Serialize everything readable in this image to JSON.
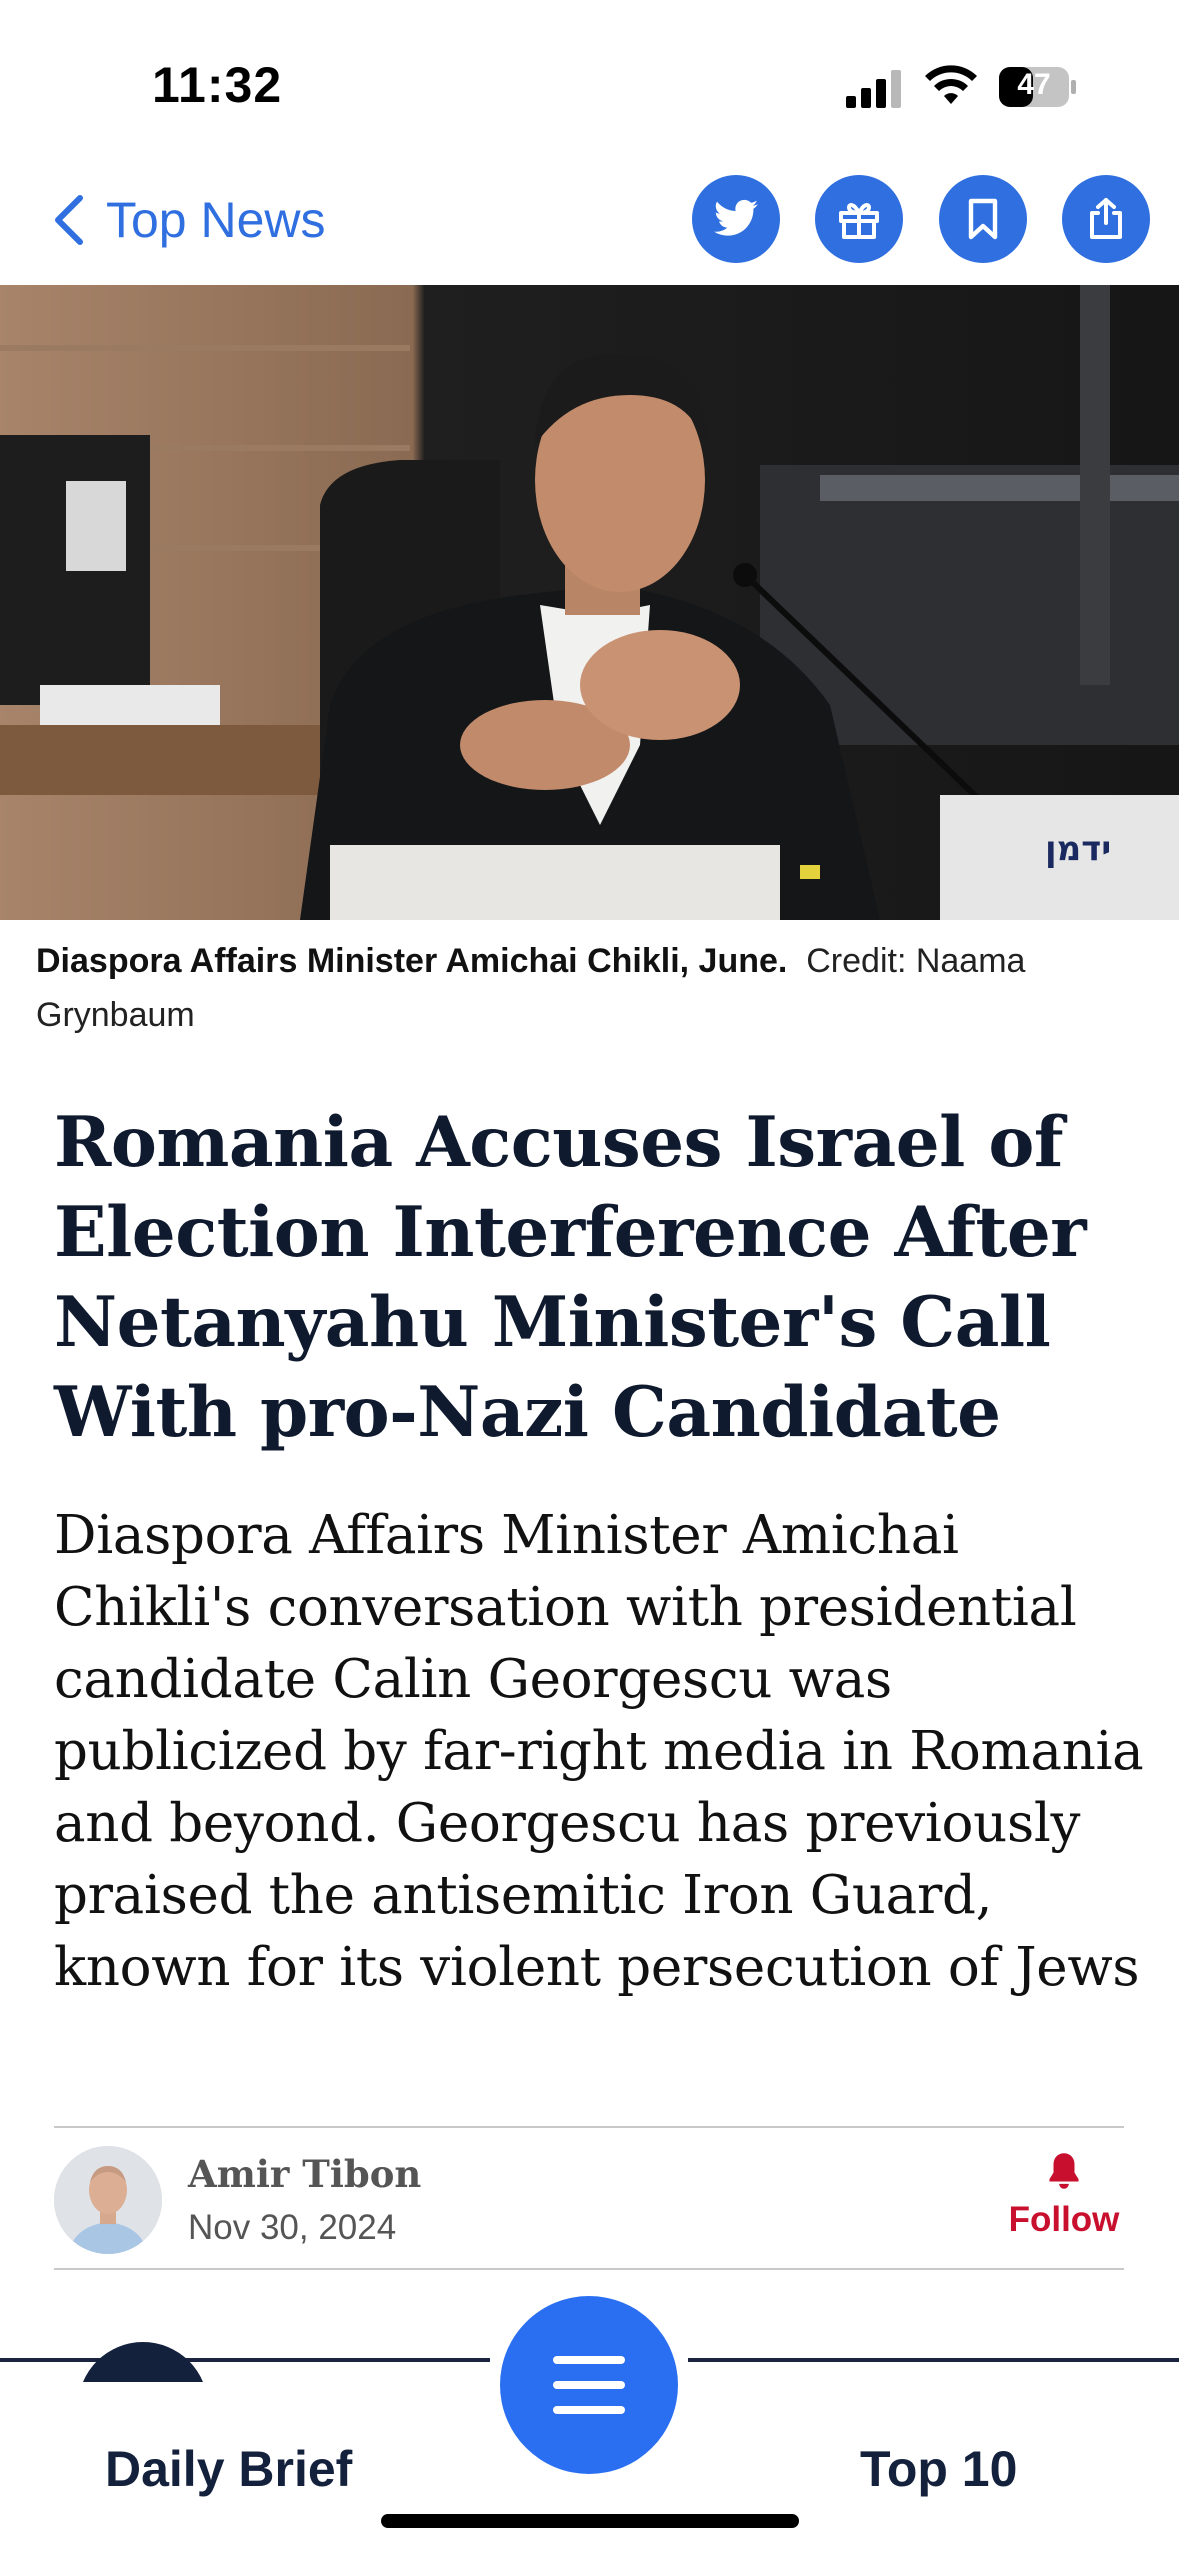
{
  "status_bar": {
    "time": "11:32",
    "battery": "47",
    "icons": [
      "signal-icon",
      "wifi-icon",
      "battery-icon"
    ]
  },
  "nav": {
    "back_label": "Top News",
    "actions": [
      "twitter-icon",
      "gift-icon",
      "bookmark-icon",
      "share-icon"
    ],
    "accent_color": "#2f6fe0"
  },
  "photo": {
    "caption_bold": "Diaspora Affairs Minister Amichai Chikli, June.",
    "caption_credit": "Credit: Naama Grynbaum"
  },
  "article": {
    "headline": "Romania Accuses Israel of Election Interference After Netanyahu Minister's Call With pro-Nazi Candidate",
    "summary": "Diaspora Affairs Minister Amichai Chikli's conversation with presidential candidate Calin Georgescu was publicized by far-right media in Romania and beyond. Georgescu has previously praised the antisemitic Iron Guard, known for its violent persecution of Jews"
  },
  "byline": {
    "author": "Amir Tibon",
    "date": "Nov 30, 2024",
    "follow_label": "Follow",
    "follow_color": "#c8102e"
  },
  "bottom_bar": {
    "left_tab": "Daily Brief",
    "right_tab": "Top 10",
    "menu_icon": "hamburger-menu-icon",
    "menu_color": "#2a6ff2"
  }
}
